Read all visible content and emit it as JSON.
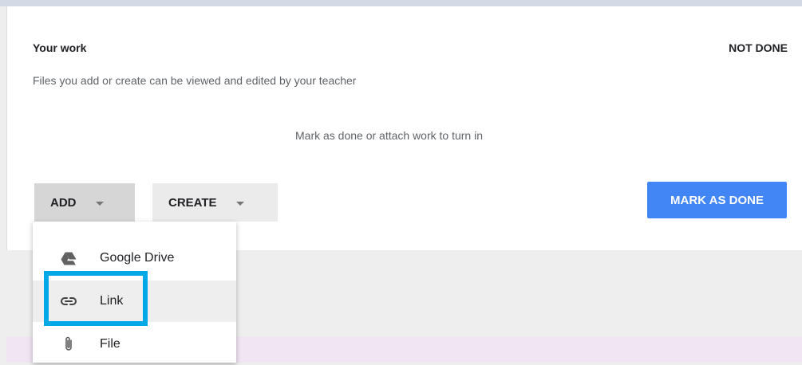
{
  "work": {
    "title": "Your work",
    "status": "NOT DONE",
    "subtitle": "Files you add or create can be viewed and edited by your teacher",
    "hint": "Mark as done or attach work to turn in"
  },
  "buttons": {
    "add_label": "ADD",
    "create_label": "CREATE",
    "mark_done_label": "MARK AS DONE"
  },
  "menu": {
    "items": [
      {
        "label": "Google Drive",
        "icon": "google-drive-icon"
      },
      {
        "label": "Link",
        "icon": "link-icon"
      },
      {
        "label": "File",
        "icon": "paperclip-icon"
      }
    ]
  },
  "colors": {
    "primary_button": "#4285f4",
    "highlight": "#00a8e8",
    "text": "#202124",
    "secondary_text": "#5f6368"
  }
}
